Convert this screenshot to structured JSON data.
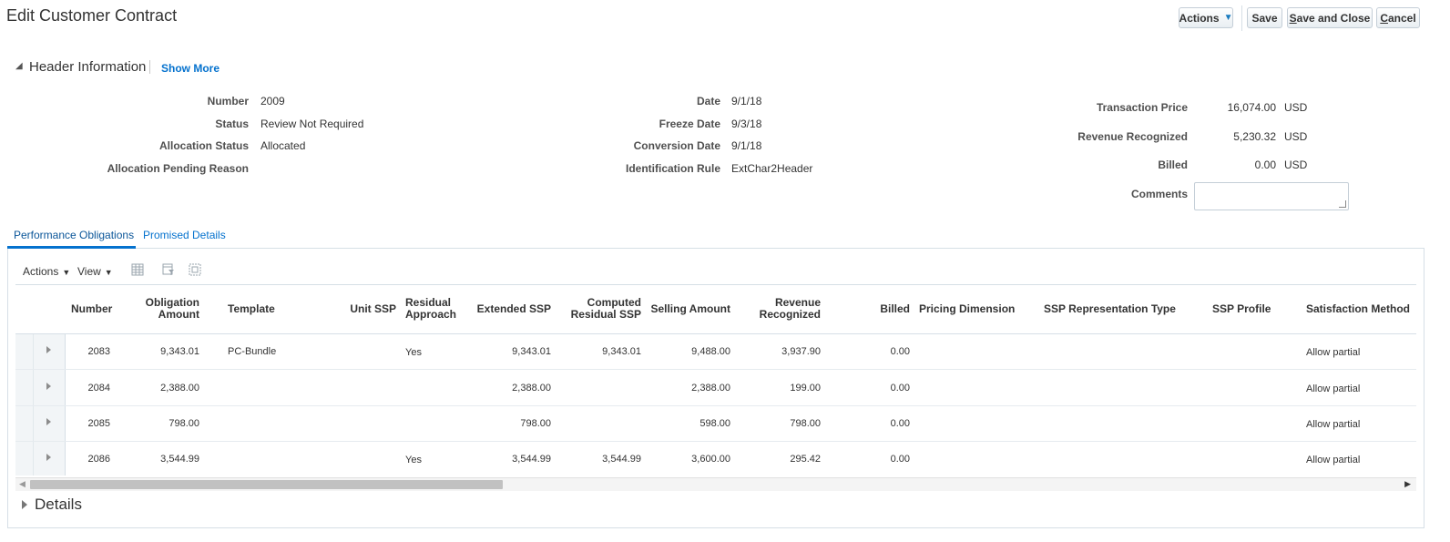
{
  "page": {
    "title": "Edit Customer Contract"
  },
  "toolbar": {
    "actions_label": "Actions",
    "save_label": "Save",
    "save_close_first": "S",
    "save_close_rest": "ave and Close",
    "cancel_first": "C",
    "cancel_rest": "ancel"
  },
  "header_section": {
    "title": "Header Information",
    "show_more": "Show More",
    "col1": [
      {
        "label": "Number",
        "value": "2009"
      },
      {
        "label": "Status",
        "value": "Review Not Required"
      },
      {
        "label": "Allocation Status",
        "value": "Allocated"
      },
      {
        "label": "Allocation Pending Reason",
        "value": ""
      }
    ],
    "col2": [
      {
        "label": "Date",
        "value": "9/1/18"
      },
      {
        "label": "Freeze Date",
        "value": "9/3/18"
      },
      {
        "label": "Conversion Date",
        "value": "9/1/18"
      },
      {
        "label": "Identification Rule",
        "value": "ExtChar2Header"
      }
    ],
    "col3": [
      {
        "label": "Transaction Price",
        "value": "16,074.00",
        "currency": "USD"
      },
      {
        "label": "Revenue Recognized",
        "value": "5,230.32",
        "currency": "USD"
      },
      {
        "label": "Billed",
        "value": "0.00",
        "currency": "USD"
      }
    ],
    "comments_label": "Comments",
    "comments_value": ""
  },
  "tabs": [
    {
      "label": "Performance Obligations",
      "active": true
    },
    {
      "label": "Promised Details",
      "active": false
    }
  ],
  "table_toolbar": {
    "actions_label": "Actions",
    "view_label": "View",
    "icons": [
      "freeze-columns-icon",
      "filter-icon",
      "detach-icon"
    ]
  },
  "table": {
    "columns": [
      {
        "line1": "Number",
        "line2": ""
      },
      {
        "line1": "Obligation",
        "line2": "Amount"
      },
      {
        "line1": "Template",
        "line2": ""
      },
      {
        "line1": "Unit SSP",
        "line2": ""
      },
      {
        "line1": "Residual",
        "line2": "Approach"
      },
      {
        "line1": "Extended SSP",
        "line2": ""
      },
      {
        "line1": "Computed",
        "line2": "Residual SSP"
      },
      {
        "line1": "Selling Amount",
        "line2": ""
      },
      {
        "line1": "Revenue",
        "line2": "Recognized"
      },
      {
        "line1": "Billed",
        "line2": ""
      },
      {
        "line1": "Pricing Dimension",
        "line2": ""
      },
      {
        "line1": "SSP Representation Type",
        "line2": ""
      },
      {
        "line1": "SSP Profile",
        "line2": ""
      },
      {
        "line1": "Satisfaction Method",
        "line2": ""
      }
    ],
    "rows": [
      {
        "number": "2083",
        "obligation_amount": "9,343.01",
        "template": "PC-Bundle",
        "unit_ssp": "",
        "residual_approach": "Yes",
        "extended_ssp": "9,343.01",
        "computed_residual_ssp": "9,343.01",
        "selling_amount": "9,488.00",
        "revenue_recognized": "3,937.90",
        "billed": "0.00",
        "pricing_dimension": "",
        "ssp_representation_type": "",
        "ssp_profile": "",
        "satisfaction_method": "Allow partial"
      },
      {
        "number": "2084",
        "obligation_amount": "2,388.00",
        "template": "",
        "unit_ssp": "",
        "residual_approach": "",
        "extended_ssp": "2,388.00",
        "computed_residual_ssp": "",
        "selling_amount": "2,388.00",
        "revenue_recognized": "199.00",
        "billed": "0.00",
        "pricing_dimension": "",
        "ssp_representation_type": "",
        "ssp_profile": "",
        "satisfaction_method": "Allow partial"
      },
      {
        "number": "2085",
        "obligation_amount": "798.00",
        "template": "",
        "unit_ssp": "",
        "residual_approach": "",
        "extended_ssp": "798.00",
        "computed_residual_ssp": "",
        "selling_amount": "598.00",
        "revenue_recognized": "798.00",
        "billed": "0.00",
        "pricing_dimension": "",
        "ssp_representation_type": "",
        "ssp_profile": "",
        "satisfaction_method": "Allow partial"
      },
      {
        "number": "2086",
        "obligation_amount": "3,544.99",
        "template": "",
        "unit_ssp": "",
        "residual_approach": "Yes",
        "extended_ssp": "3,544.99",
        "computed_residual_ssp": "3,544.99",
        "selling_amount": "3,600.00",
        "revenue_recognized": "295.42",
        "billed": "0.00",
        "pricing_dimension": "",
        "ssp_representation_type": "",
        "ssp_profile": "",
        "satisfaction_method": "Allow partial"
      }
    ]
  },
  "details_section": {
    "title": "Details"
  },
  "colors": {
    "link": "#0572ce",
    "border": "#d6dfe6",
    "gutter": "#f2f5f7"
  }
}
